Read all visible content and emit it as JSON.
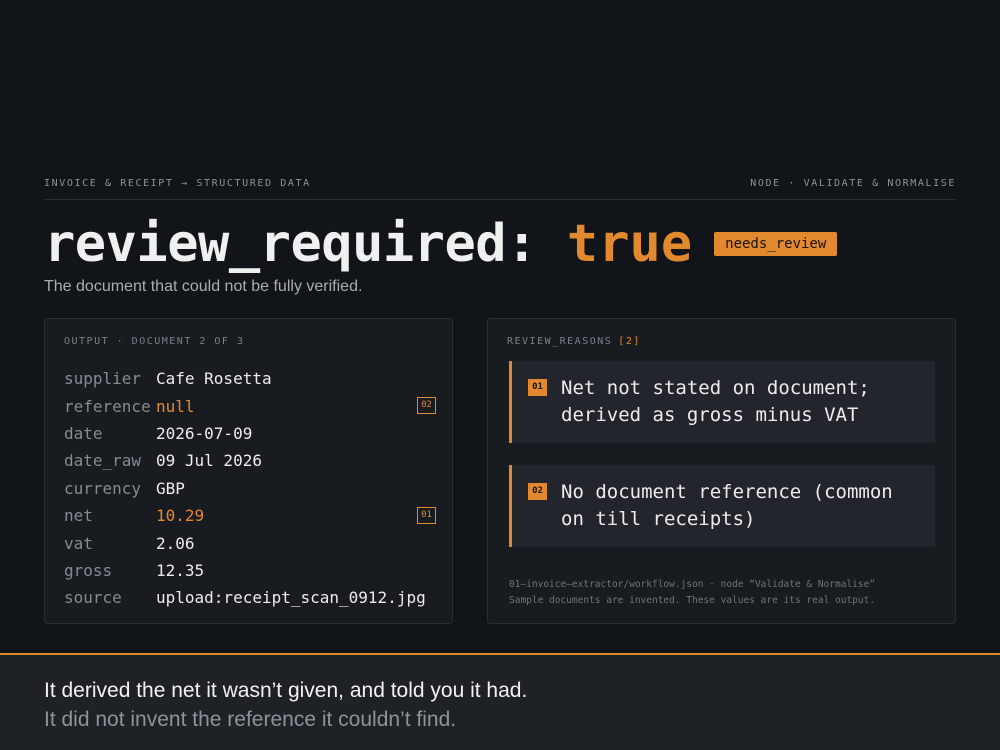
{
  "header": {
    "left": "INVOICE & RECEIPT → STRUCTURED DATA",
    "right": "NODE · VALIDATE & NORMALISE"
  },
  "headline": {
    "key": "review_required:",
    "value": "true",
    "badge": "needs_review",
    "subtitle": "The document that could not be fully verified."
  },
  "output_panel": {
    "label": "OUTPUT · DOCUMENT 2 OF 3",
    "rows": [
      {
        "key": "supplier",
        "value": "Cafe Rosetta",
        "highlight": false,
        "tag": ""
      },
      {
        "key": "reference",
        "value": "null",
        "highlight": true,
        "tag": "02"
      },
      {
        "key": "date",
        "value": "2026-07-09",
        "highlight": false,
        "tag": ""
      },
      {
        "key": "date_raw",
        "value": "09 Jul 2026",
        "highlight": false,
        "tag": ""
      },
      {
        "key": "currency",
        "value": "GBP",
        "highlight": false,
        "tag": ""
      },
      {
        "key": "net",
        "value": "10.29",
        "highlight": true,
        "tag": "01"
      },
      {
        "key": "vat",
        "value": "2.06",
        "highlight": false,
        "tag": ""
      },
      {
        "key": "gross",
        "value": "12.35",
        "highlight": false,
        "tag": ""
      },
      {
        "key": "source",
        "value": "upload:receipt_scan_0912.jpg",
        "highlight": false,
        "tag": ""
      }
    ]
  },
  "review_panel": {
    "label": "REVIEW_REASONS",
    "count": "[2]",
    "reasons": [
      {
        "num": "01",
        "text": "Net not stated on document; derived as gross minus VAT"
      },
      {
        "num": "02",
        "text": "No document reference (common on till receipts)"
      }
    ],
    "footnote_line1": "01—invoice—extractor/workflow.json · node “Validate & Normalise”",
    "footnote_line2": "Sample documents are invented. These values are its real output."
  },
  "footer": {
    "line1": "It derived the net it wasn’t given, and told you it had.",
    "line2": "It did not invent the reference it couldn’t find."
  },
  "colors": {
    "accent": "#e2892f",
    "background": "#111418",
    "panel": "#181b20"
  }
}
